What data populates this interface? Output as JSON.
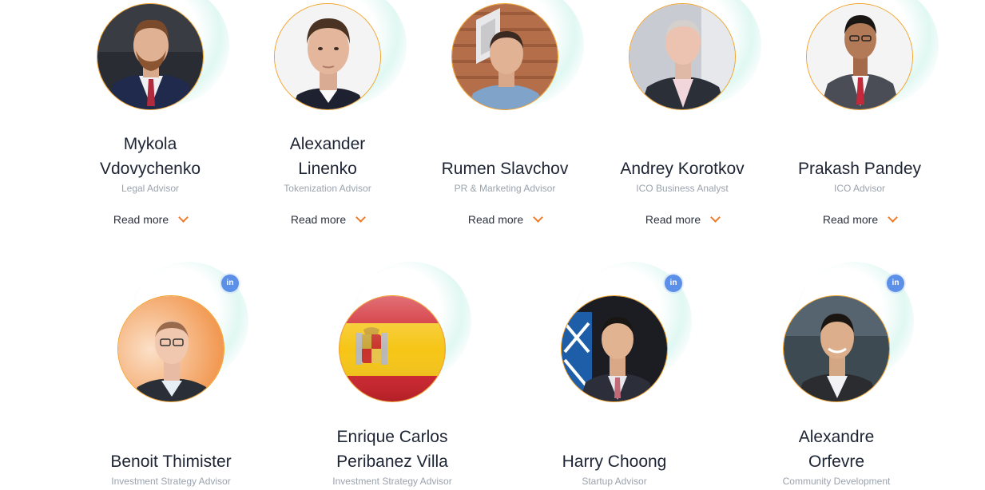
{
  "row1": [
    {
      "id": "mykola",
      "name_lines": [
        "Mykola",
        "Vdovychenko"
      ],
      "role": "Legal Advisor",
      "read_more": "Read more"
    },
    {
      "id": "alexander-l",
      "name_lines": [
        "Alexander",
        "Linenko"
      ],
      "role": "Tokenization Advisor",
      "read_more": "Read more"
    },
    {
      "id": "rumen",
      "name_lines": [
        "Rumen Slavchov"
      ],
      "role": "PR & Marketing Advisor",
      "read_more": "Read more"
    },
    {
      "id": "andrey",
      "name_lines": [
        "Andrey Korotkov"
      ],
      "role": "ICO Business Analyst",
      "read_more": "Read more"
    },
    {
      "id": "prakash",
      "name_lines": [
        "Prakash Pandey"
      ],
      "role": "ICO Advisor",
      "read_more": "Read more"
    }
  ],
  "row2": [
    {
      "id": "benoit",
      "name_lines": [
        "Benoit Thimister"
      ],
      "role": "Investment Strategy Advisor",
      "linkedin": "in"
    },
    {
      "id": "enrique",
      "name_lines": [
        "Enrique Carlos",
        "Peribanez Villa"
      ],
      "role": "Investment Strategy Advisor"
    },
    {
      "id": "harry",
      "name_lines": [
        "Harry Choong"
      ],
      "role": "Startup Advisor",
      "linkedin": "in"
    },
    {
      "id": "alexandre",
      "name_lines": [
        "Alexandre",
        "Orfevre"
      ],
      "role": "Community Development",
      "linkedin": "in"
    }
  ],
  "colors": {
    "accent": "#f07a2a",
    "ring": "#f2a229",
    "linkedin": "#5b8fe8",
    "name": "#1d2433",
    "role": "#9aa3ad"
  }
}
